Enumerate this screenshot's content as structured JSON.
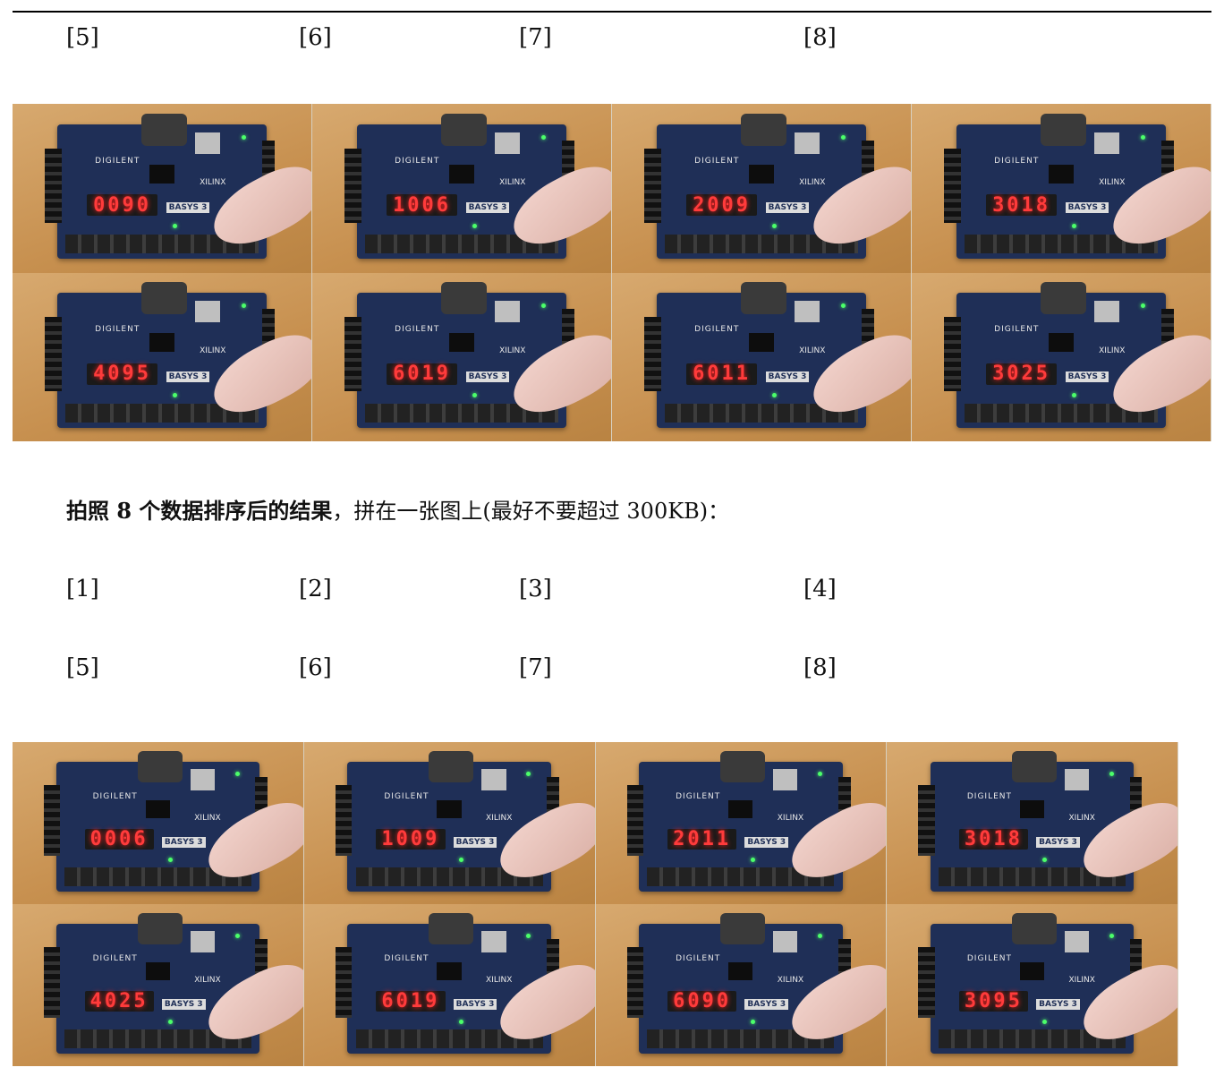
{
  "top_labels": [
    "[5]",
    "[6]",
    "[7]",
    "[8]"
  ],
  "grid_a": [
    "0090",
    "1006",
    "2009",
    "3018",
    "4095",
    "6019",
    "6011",
    "3025"
  ],
  "caption": {
    "bold": "拍照 8 个数据排序后的结果",
    "rest": "，拼在一张图上(最好不要超过 300KB)："
  },
  "labels_row1": [
    "[1]",
    "[2]",
    "[3]",
    "[4]"
  ],
  "labels_row2": [
    "[5]",
    "[6]",
    "[7]",
    "[8]"
  ],
  "grid_b": [
    "0006",
    "1009",
    "2011",
    "3018",
    "4025",
    "6019",
    "6090",
    "3095"
  ],
  "board": {
    "brand": "DIGILENT",
    "vendor": "XILINX",
    "model": "BASYS 3"
  }
}
